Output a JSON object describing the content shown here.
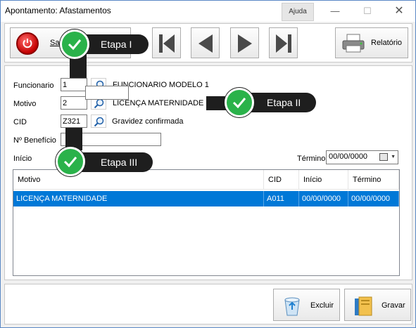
{
  "window": {
    "title": "Apontamento: Afastamentos",
    "help_label": "Ajuda",
    "minimize_glyph": "—",
    "maximize_glyph": "☐",
    "close_glyph": "✕"
  },
  "toolbar": {
    "exit_label": "Sair",
    "report_label": "Relatório",
    "icons": [
      "power-icon",
      "first-record-icon",
      "previous-record-icon",
      "next-record-icon",
      "last-record-icon",
      "printer-icon"
    ]
  },
  "form": {
    "funcionario_label": "Funcionario",
    "funcionario_value": "1",
    "funcionario_name": "FUNCIONARIO MODELO 1",
    "motivo_label": "Motivo",
    "motivo_value": "2",
    "motivo_name": "LICENÇA MATERNIDADE",
    "cid_label": "CID",
    "cid_value": "Z321",
    "cid_description": "Gravidez confirmada",
    "beneficio_label": "Nº Benefício",
    "beneficio_value": "",
    "inicio_label": "Início",
    "termino_label": "Término",
    "termino_value": "00/00/0000"
  },
  "grid": {
    "columns": [
      "Motivo",
      "CID",
      "Início",
      "Término"
    ],
    "rows": [
      {
        "motivo": "LICENÇA MATERNIDADE",
        "cid": "A011",
        "inicio": "00/00/0000",
        "termino": "00/00/0000"
      }
    ],
    "selection_color": "#0078d7"
  },
  "bottom": {
    "delete_label": "Excluir",
    "save_label": "Gravar"
  },
  "callouts": {
    "step1": "Etapa I",
    "step2": "Etapa II",
    "step3": "Etapa III",
    "accent_color": "#2ab24a"
  }
}
